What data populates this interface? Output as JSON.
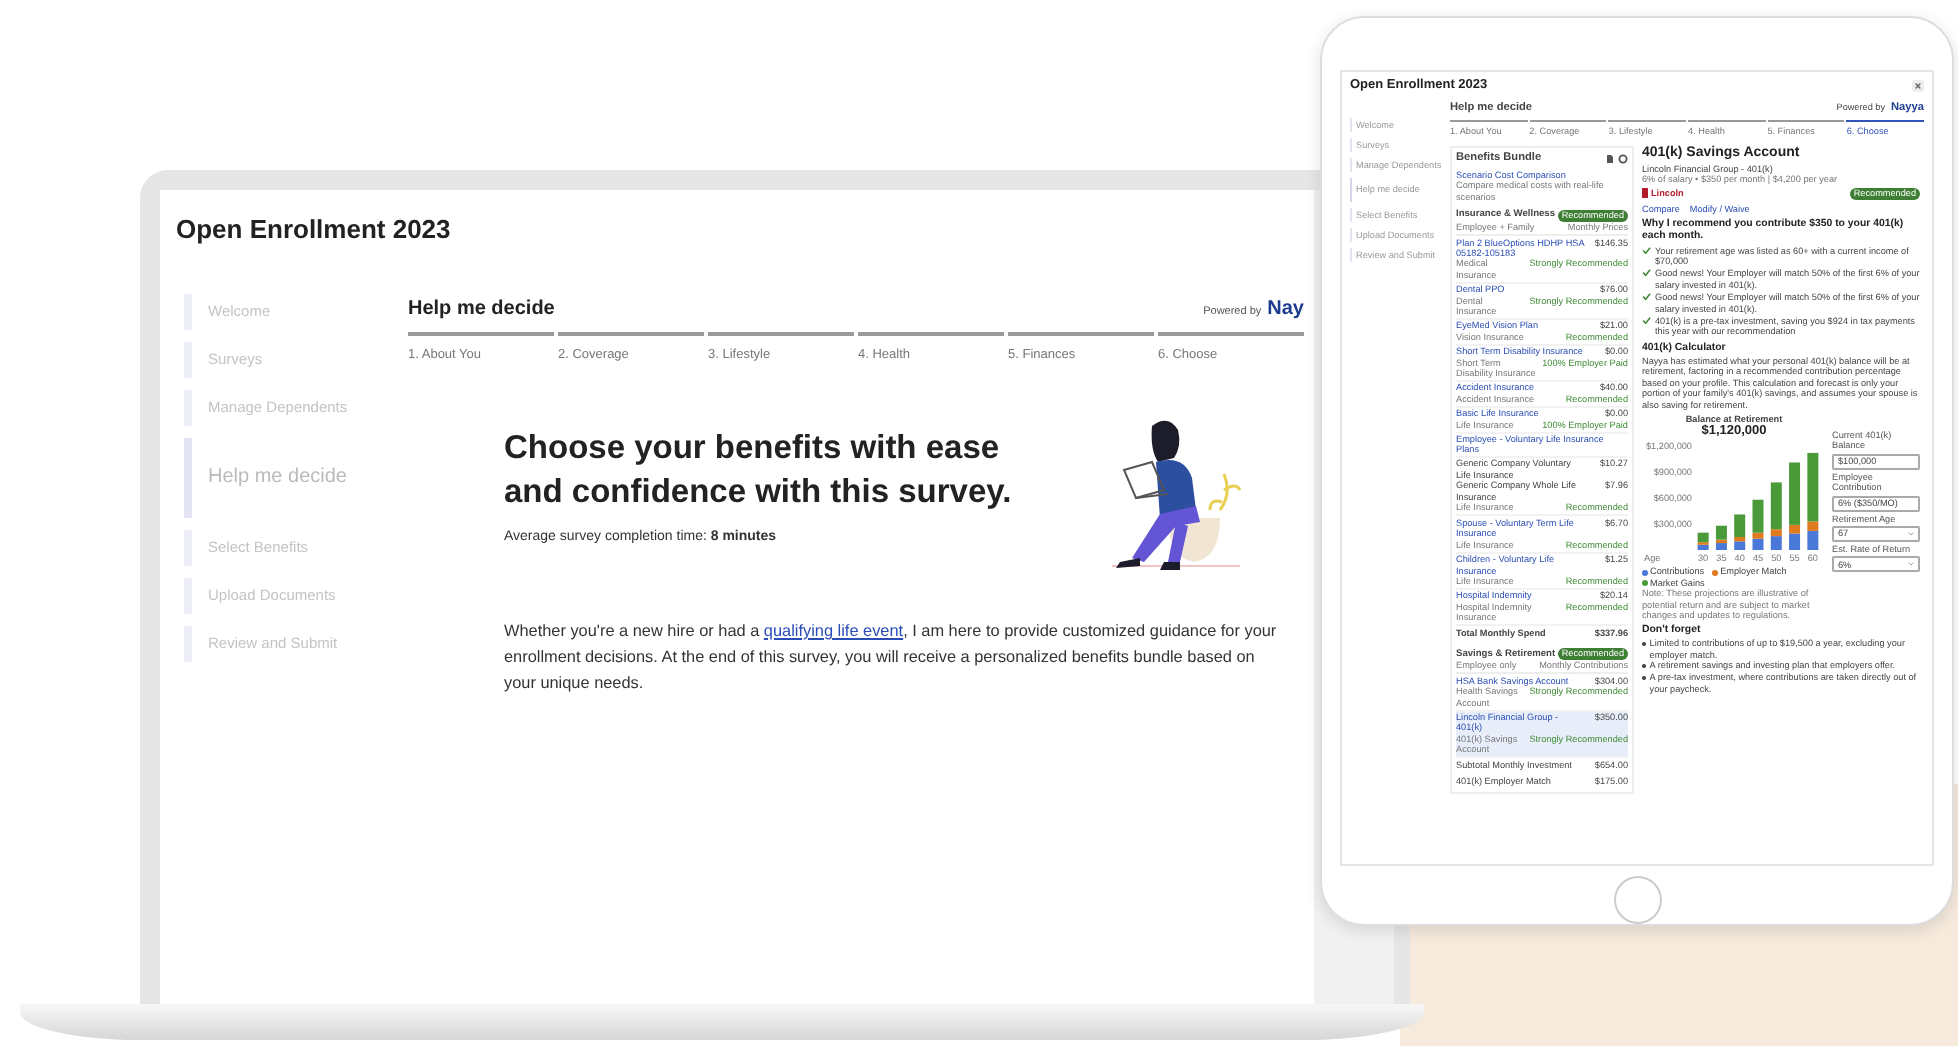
{
  "laptop": {
    "title": "Open Enrollment 2023",
    "sidebar": [
      {
        "label": "Welcome",
        "selected": false
      },
      {
        "label": "Surveys",
        "selected": false
      },
      {
        "label": "Manage Dependents",
        "selected": false
      },
      {
        "label": "Help me decide",
        "selected": true
      },
      {
        "label": "Select Benefits",
        "selected": false
      },
      {
        "label": "Upload Documents",
        "selected": false
      },
      {
        "label": "Review and Submit",
        "selected": false
      }
    ],
    "header": {
      "title": "Help me decide",
      "powered_by": "Powered by",
      "brand": "Nay"
    },
    "steps": [
      "1. About You",
      "2. Coverage",
      "3. Lifestyle",
      "4. Health",
      "5. Finances",
      "6. Choose"
    ],
    "hero": {
      "heading": "Choose your benefits with ease and confidence with this survey.",
      "completion": "Average survey completion time: **8 minutes**",
      "intro_before": "Whether you're a new hire or had a",
      "intro_link": "qualifying life event",
      "intro_after": ", I am here to provide customized guidance for your enrollment decisions. At the end of this survey, you will receive a personalized benefits bundle based on your unique needs."
    }
  },
  "tablet": {
    "title": "Open Enrollment 2023",
    "sidebar": [
      {
        "label": "Welcome",
        "selected": false
      },
      {
        "label": "Surveys",
        "selected": false
      },
      {
        "label": "Manage Dependents",
        "selected": false
      },
      {
        "label": "Help me decide",
        "selected": true
      },
      {
        "label": "Select Benefits",
        "selected": false
      },
      {
        "label": "Upload Documents",
        "selected": false
      },
      {
        "label": "Review and Submit",
        "selected": false
      }
    ],
    "header": {
      "title": "Help me decide",
      "powered_by": "Powered by",
      "brand": "Nayya"
    },
    "steps": [
      {
        "label": "1. About You",
        "selected": false
      },
      {
        "label": "2. Coverage",
        "selected": false
      },
      {
        "label": "3. Lifestyle",
        "selected": false
      },
      {
        "label": "4. Health",
        "selected": false
      },
      {
        "label": "5. Finances",
        "selected": false
      },
      {
        "label": "6. Choose",
        "selected": true
      }
    ],
    "bundle": {
      "title": "Benefits Bundle",
      "scenario_link": "Scenario Cost Comparison",
      "scenario_note": "Compare medical costs with real-life scenarios",
      "sections": [
        {
          "title": "Insurance & Wellness",
          "badge": "Recommended",
          "sub_left": "Employee + Family",
          "sub_right": "Monthly Prices",
          "rows": [
            {
              "kind": "plan",
              "name": "Plan 2 BlueOptions HDHP HSA 05182-105183",
              "price": "$146.35",
              "type": "Medical Insurance",
              "rating": "Strongly Recommended",
              "selected": false
            },
            {
              "kind": "plan",
              "name": "Dental PPO",
              "price": "$76.00",
              "type": "Dental Insurance",
              "rating": "Strongly Recommended",
              "selected": false
            },
            {
              "kind": "plan",
              "name": "EyeMed Vision Plan",
              "price": "$21.00",
              "type": "Vision Insurance",
              "rating": "Recommended",
              "selected": false
            },
            {
              "kind": "plan",
              "name": "Short Term Disability Insurance",
              "price": "$0.00",
              "type": "Short Term Disability Insurance",
              "rating": "100% Employer Paid",
              "selected": false
            },
            {
              "kind": "plan",
              "name": "Accident Insurance",
              "price": "$40.00",
              "type": "Accident Insurance",
              "rating": "Recommended",
              "selected": false
            },
            {
              "kind": "plan",
              "name": "Basic Life Insurance",
              "price": "$0.00",
              "type": "Life Insurance",
              "rating": "100% Employer Paid",
              "selected": false
            },
            {
              "kind": "group",
              "name": "Employee - Voluntary Life Insurance Plans"
            },
            {
              "kind": "subplan",
              "name": "Generic Company Voluntary Life Insurance",
              "price": "$10.27"
            },
            {
              "kind": "subplan",
              "name": "Generic Company Whole Life Insurance",
              "price": "$7.96"
            },
            {
              "kind": "note",
              "type": "Life Insurance",
              "rating": "Recommended"
            },
            {
              "kind": "plan",
              "name": "Spouse - Voluntary Term Life Insurance",
              "price": "$6.70",
              "type": "Life Insurance",
              "rating": "Recommended",
              "selected": false
            },
            {
              "kind": "plan",
              "name": "Children - Voluntary Life Insurance",
              "price": "$1.25",
              "type": "Life Insurance",
              "rating": "Recommended",
              "selected": false
            },
            {
              "kind": "plan",
              "name": "Hospital Indemnity",
              "price": "$20.14",
              "type": "Hospital Indemnity Insurance",
              "rating": "Recommended",
              "selected": false
            },
            {
              "kind": "total",
              "name": "Total Monthly Spend",
              "price": "$337.96"
            }
          ]
        },
        {
          "title": "Savings & Retirement",
          "badge": "Recommended",
          "sub_left": "Employee only",
          "sub_right": "Monthly Contributions",
          "rows": [
            {
              "kind": "plan",
              "name": "HSA Bank Savings Account",
              "price": "$304.00",
              "type": "Health Savings Account",
              "rating": "Strongly Recommended",
              "selected": false
            },
            {
              "kind": "plan",
              "name": "Lincoln Financial Group - 401(k)",
              "price": "$350.00",
              "type": "401(k) Savings Account",
              "rating": "Strongly Recommended",
              "selected": true
            },
            {
              "kind": "summary",
              "name": "Subtotal Monthly Investment",
              "price": "$654.00"
            },
            {
              "kind": "summary",
              "name": "401(k) Employer Match",
              "price": "$175.00"
            }
          ]
        }
      ]
    },
    "detail": {
      "title": "401(k) Savings Account",
      "provider": "Lincoln Financial Group - 401(k)",
      "provider_detail": "6% of salary • $350 per month | $4,200 per year",
      "logo": "Lincoln",
      "badge": "Recommended",
      "links": [
        "Compare",
        "Modify / Waive"
      ],
      "reason_heading": "Why I recommend you contribute $350 to your 401(k) each month.",
      "reasons": [
        "Your retirement age was listed as 60+ with a current income of $70,000",
        "Good news! Your Employer will match 50% of the first 6% of your salary invested in 401(k).",
        "Good news! Your Employer will match 50% of the first 6% of your salary invested in 401(k).",
        "401(k) is a pre-tax investment, saving you $924 in tax payments this year with our recommendation"
      ],
      "calculator_title": "401(k) Calculator",
      "calculator_text": "Nayya has estimated what your personal 401(k) balance will be at retirement, factoring in a recommended contribution percentage based on your profile. This calculation and forecast is only your portion of your family's 401(k) savings, and assumes your spouse is also saving for retirement.",
      "balance_label": "Balance at Retirement",
      "balance_total": "$1,120,000",
      "chart_data": {
        "type": "bar",
        "stacked": true,
        "xlabel": "Age",
        "categories": [
          "30",
          "35",
          "40",
          "45",
          "50",
          "55",
          "60"
        ],
        "series": [
          {
            "name": "Contributions",
            "color": "#4a78d8",
            "values": [
              60000,
              80000,
              100000,
              130000,
              160000,
              190000,
              220000
            ]
          },
          {
            "name": "Employer Match",
            "color": "#e07a1f",
            "values": [
              30000,
              40000,
              50000,
              70000,
              80000,
              100000,
              110000
            ]
          },
          {
            "name": "Market Gains",
            "color": "#4a9a3a",
            "values": [
              110000,
              160000,
              260000,
              380000,
              540000,
              720000,
              790000
            ]
          }
        ],
        "ylim": [
          0,
          1200000
        ],
        "yticks": [
          {
            "value": 300000,
            "label": "$300,000"
          },
          {
            "value": 600000,
            "label": "$600,000"
          },
          {
            "value": 900000,
            "label": "$900,000"
          },
          {
            "value": 1200000,
            "label": "$1,200,000"
          }
        ]
      },
      "chart_note": "Note: These projections are illustrative of potential return and are subject to market changes and updates to regulations.",
      "fields": [
        {
          "kind": "input",
          "label": "Current 401(k) Balance",
          "value": "$100,000"
        },
        {
          "kind": "input",
          "label": "Employee Contribution",
          "value": "6% ($350/MO)"
        },
        {
          "kind": "select",
          "label": "Retirement Age",
          "value": "67"
        },
        {
          "kind": "select",
          "label": "Est. Rate of Return",
          "value": "6%"
        }
      ],
      "dont_forget_title": "Don't forget",
      "dont_forget": [
        "Limited to contributions of up to $19,500 a year, excluding your employer match.",
        "A retirement savings and investing plan that employers offer.",
        "A pre-tax investment, where contributions are taken directly out of your paycheck."
      ]
    }
  }
}
